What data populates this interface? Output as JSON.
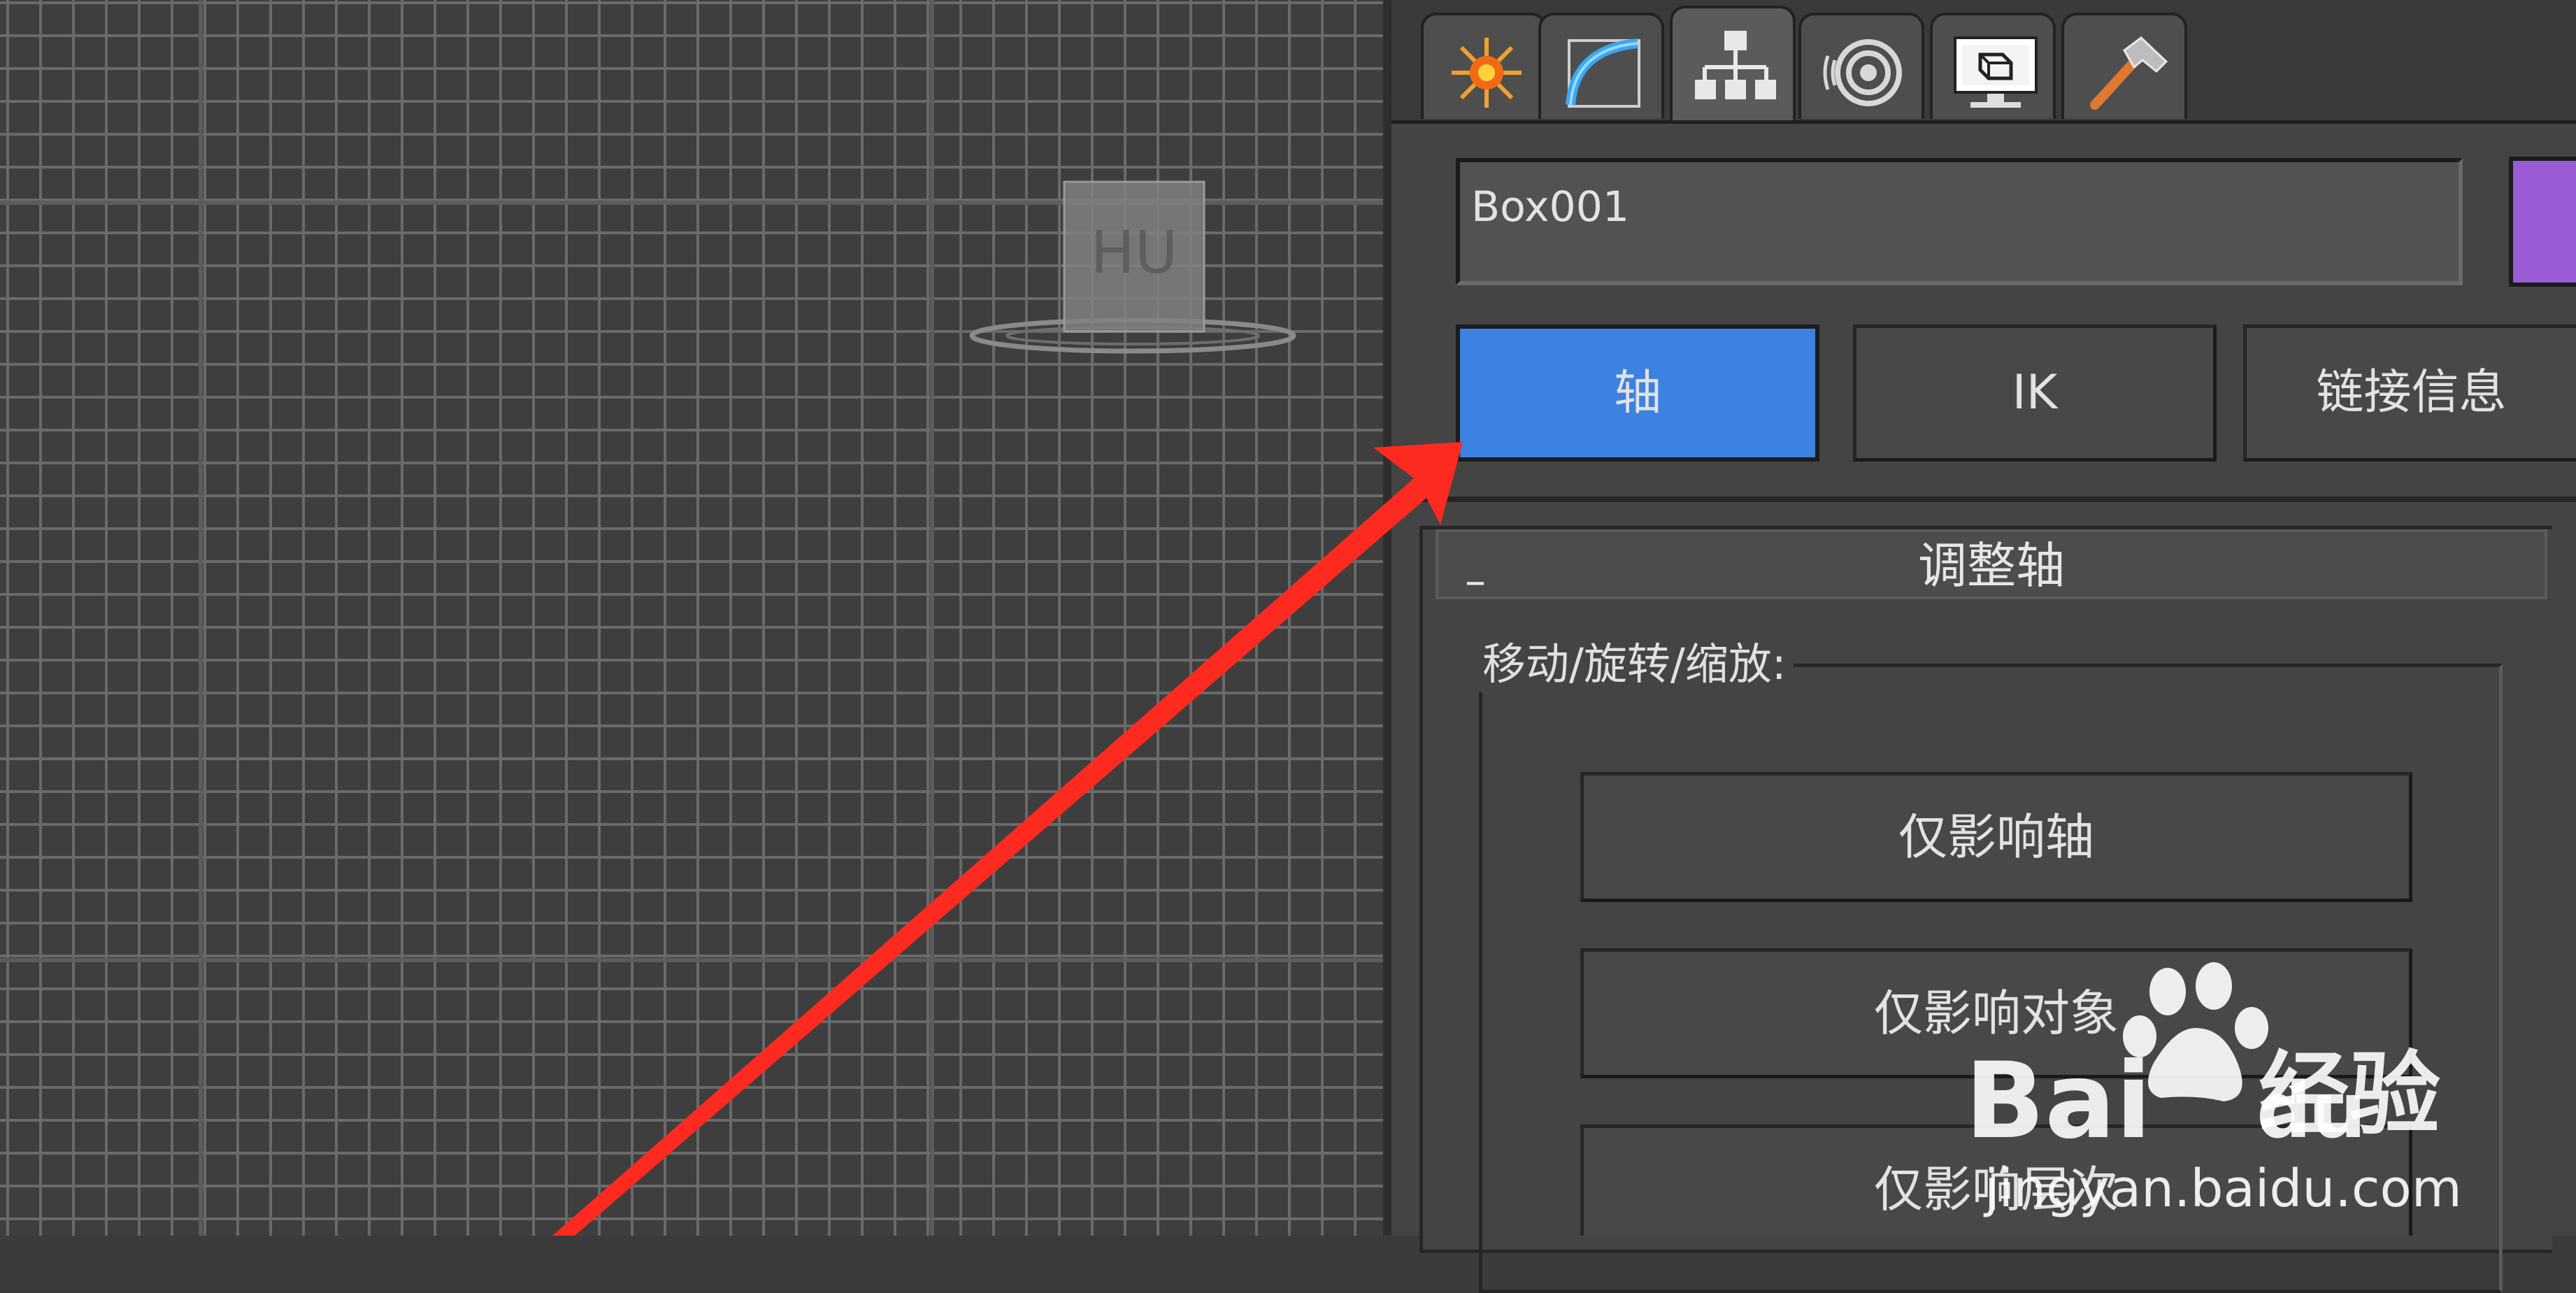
{
  "viewport": {
    "helper_label": "HU"
  },
  "command_panel": {
    "tabs": [
      {
        "name": "create-tab",
        "icon": "sun-burst-icon"
      },
      {
        "name": "modify-tab",
        "icon": "bend-curve-icon"
      },
      {
        "name": "hierarchy-tab",
        "icon": "hierarchy-icon",
        "active": true
      },
      {
        "name": "motion-tab",
        "icon": "motion-rings-icon"
      },
      {
        "name": "display-tab",
        "icon": "monitor-icon"
      },
      {
        "name": "utilities-tab",
        "icon": "hammer-icon"
      }
    ],
    "object_name": "Box001",
    "object_color": "#9a5bd4",
    "mode_buttons": {
      "pivot": "轴",
      "ik": "IK",
      "link_info": "链接信息"
    },
    "rollout": {
      "title": "调整轴",
      "collapse_symbol": "–",
      "group_label": "移动/旋转/缩放:",
      "buttons": {
        "affect_pivot_only": "仅影响轴",
        "affect_object_only": "仅影响对象",
        "affect_hierarchy_only": "仅影响层次"
      }
    }
  },
  "colors": {
    "active_button": "#3c82e0",
    "annotation_arrow": "#ff2a1f"
  },
  "watermark": {
    "brand": "Bai",
    "brand_suffix": "du",
    "product": "经验",
    "url": "jingyan.baidu.com"
  }
}
